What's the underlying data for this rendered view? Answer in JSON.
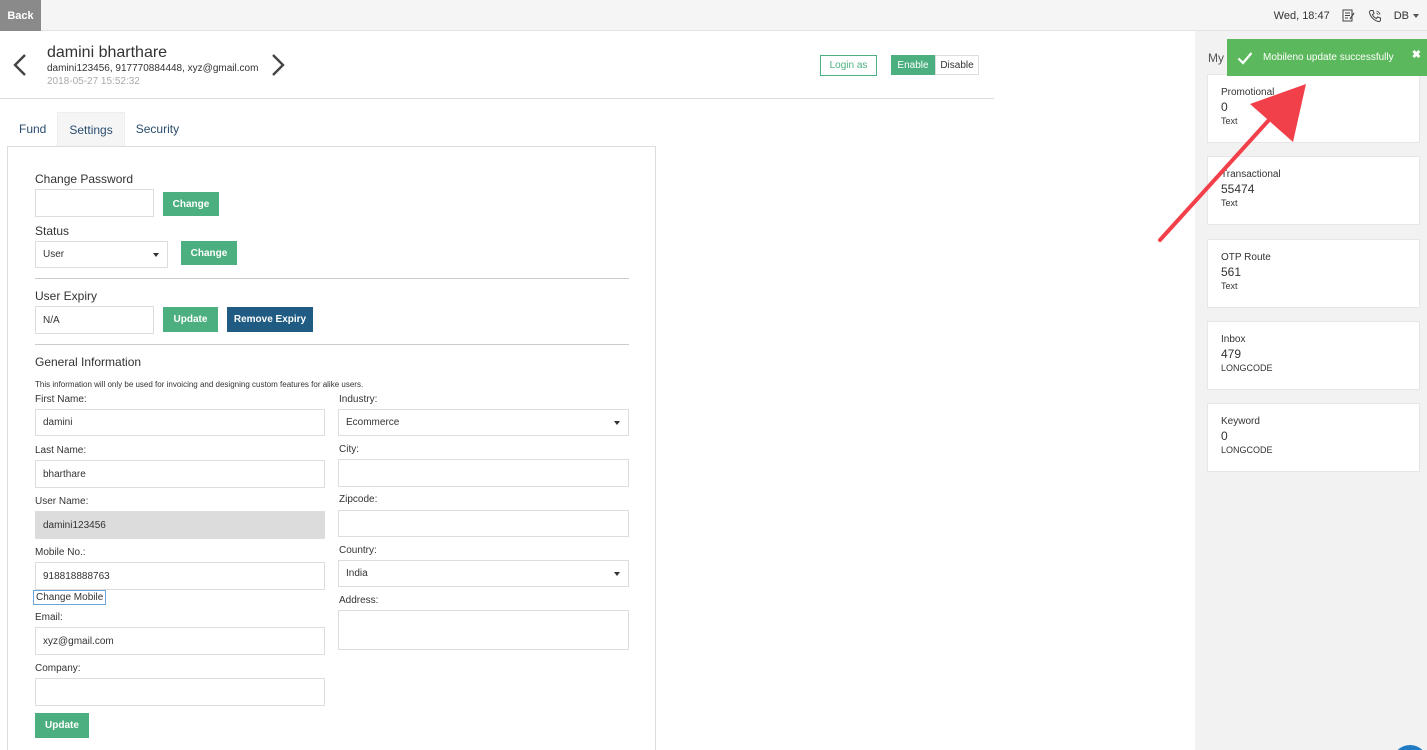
{
  "topbar": {
    "back_label": "Back",
    "datetime": "Wed, 18:47",
    "user_initials": "DB",
    "icons": [
      "notepad-icon",
      "phone-icon",
      "chevron-down-icon"
    ]
  },
  "profile": {
    "name": "damini bharthare",
    "meta": "damini123456, 917770884448, xyz@gmail.com",
    "date": "2018-05-27 15:52:32",
    "login_as_label": "Login as",
    "enable_label": "Enable",
    "disable_label": "Disable"
  },
  "tabs": [
    {
      "label": "Fund"
    },
    {
      "label": "Settings"
    },
    {
      "label": "Security"
    }
  ],
  "form": {
    "change_password_label": "Change Password",
    "change_password_value": "",
    "change_button": "Change",
    "status_label": "Status",
    "status_value": "User",
    "status_change_button": "Change",
    "user_expiry_label": "User Expiry",
    "user_expiry_value": "N/A",
    "update_button": "Update",
    "remove_expiry_button": "Remove Expiry",
    "general_info_title": "General Information",
    "general_info_note": "This information will only be used for invoicing and designing custom features for alike users.",
    "first_name_label": "First Name:",
    "first_name_value": "damini",
    "last_name_label": "Last Name:",
    "last_name_value": "bharthare",
    "user_name_label": "User Name:",
    "user_name_value": "damini123456",
    "mobile_label": "Mobile No.:",
    "mobile_value": "918818888763",
    "change_mobile_button": "Change Mobile",
    "email_label": "Email:",
    "email_value": "xyz@gmail.com",
    "company_label": "Company:",
    "company_value": "",
    "industry_label": "Industry:",
    "industry_value": "Ecommerce",
    "city_label": "City:",
    "city_value": "",
    "zipcode_label": "Zipcode:",
    "zipcode_value": "",
    "country_label": "Country:",
    "country_value": "India",
    "address_label": "Address:",
    "address_value": "",
    "general_update_button": "Update"
  },
  "balance": {
    "title": "My Balance",
    "cards": [
      {
        "name": "Promotional",
        "value": "0",
        "unit": "Text"
      },
      {
        "name": "Transactional",
        "value": "55474",
        "unit": "Text"
      },
      {
        "name": "OTP Route",
        "value": "561",
        "unit": "Text"
      },
      {
        "name": "Inbox",
        "value": "479",
        "unit": "LONGCODE"
      },
      {
        "name": "Keyword",
        "value": "0",
        "unit": "LONGCODE"
      }
    ]
  },
  "toast": {
    "message": "Mobileno update successfully",
    "close_symbol": "✖"
  },
  "colors": {
    "green": "#4caf7f",
    "dark_blue": "#1f5b83",
    "toast_green": "#5cb85c",
    "arrow_red": "#f2404a"
  }
}
